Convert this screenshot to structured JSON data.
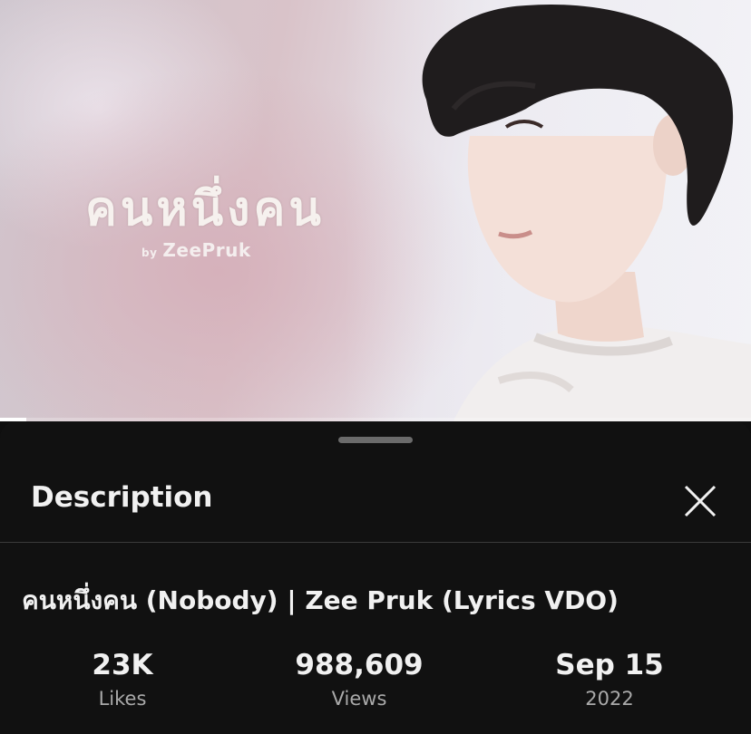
{
  "video": {
    "thumbnail_title": "คนหนึ่งคน",
    "thumbnail_by": "by",
    "thumbnail_artist": "ZeePruk",
    "progress_fraction": 0.035
  },
  "sheet": {
    "title": "Description",
    "close_icon": "close-icon"
  },
  "description": {
    "video_title": "คนหนึ่งคน (Nobody) | Zee Pruk (Lyrics VDO)",
    "stats": [
      {
        "value": "23K",
        "label": "Likes"
      },
      {
        "value": "988,609",
        "label": "Views"
      },
      {
        "value": "Sep 15",
        "label": "2022"
      }
    ]
  },
  "colors": {
    "sheet_background": "#111111",
    "primary_text": "#f1f1f1",
    "secondary_text": "#aaaaaa",
    "divider": "#3a3a3a"
  }
}
